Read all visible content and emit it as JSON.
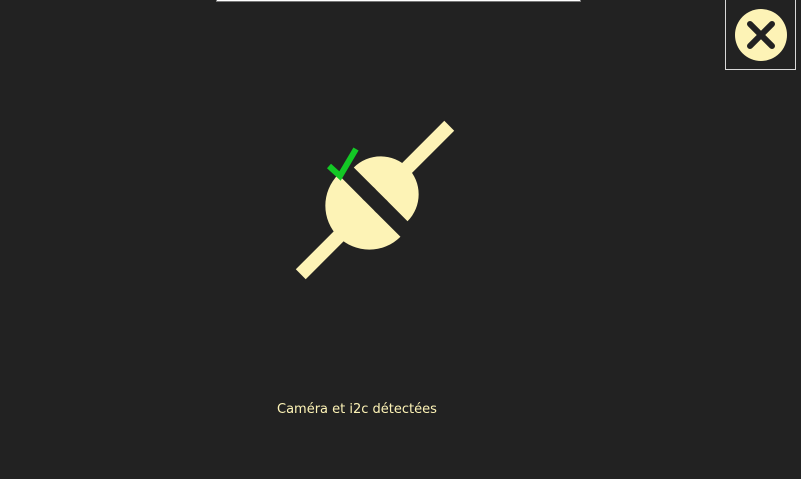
{
  "status": {
    "message": "Caméra et i2c détectées"
  },
  "close": {
    "icon": "close-icon"
  },
  "connection": {
    "icon": "plug-connected-icon",
    "check_icon": "check-icon"
  },
  "colors": {
    "background": "#222222",
    "accent": "#fdf3b6",
    "success": "#13c925",
    "icon_dark": "#222222"
  }
}
